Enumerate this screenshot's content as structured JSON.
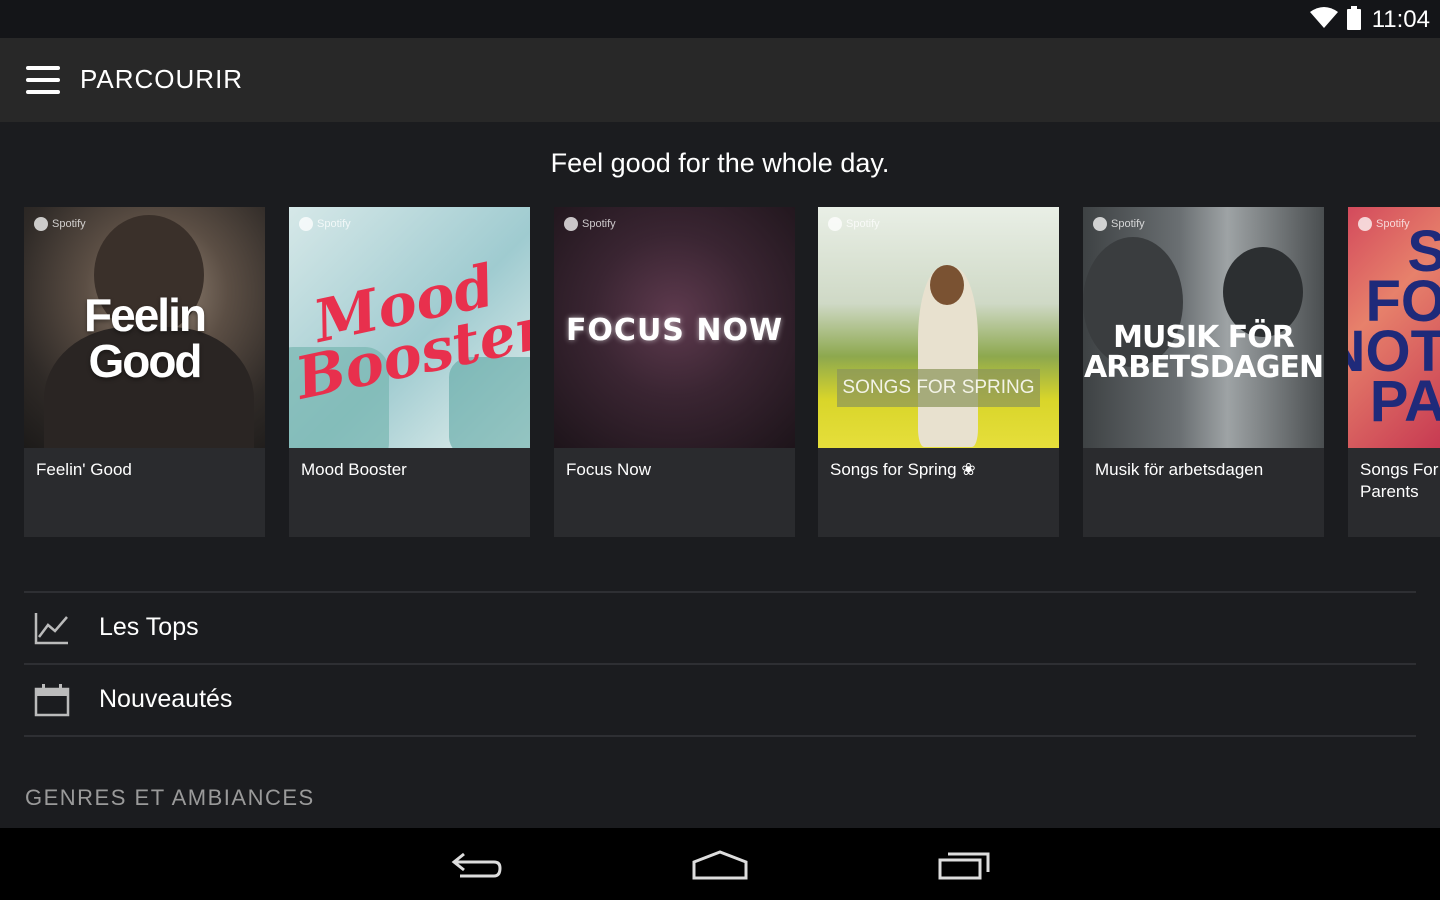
{
  "status_bar": {
    "time": "11:04"
  },
  "app_bar": {
    "title": "PARCOURIR"
  },
  "featured": {
    "tagline": "Feel good for the whole day.",
    "playlists": [
      {
        "label": "Feelin' Good",
        "art_text": "Feelin Good"
      },
      {
        "label": "Mood Booster",
        "art_text": "Mood Booster"
      },
      {
        "label": "Focus Now",
        "art_text": "FOCUS NOW"
      },
      {
        "label": "Songs for Spring ❀",
        "art_text": "SONGS FOR SPRING"
      },
      {
        "label": "Musik för arbetsdagen",
        "art_text": "MUSIK FÖR ARBETSDAGEN"
      },
      {
        "label": "Songs For Parents",
        "art_text": "S FO NOT PA"
      }
    ],
    "brand_mark": "Spotify"
  },
  "menu_rows": [
    {
      "label": "Les Tops",
      "icon": "chart-line-icon"
    },
    {
      "label": "Nouveautés",
      "icon": "calendar-icon"
    }
  ],
  "sections": {
    "genres_heading": "GENRES ET AMBIANCES"
  },
  "colors": {
    "background": "#1b1c1f",
    "app_bar": "#282828",
    "card": "#2a2b2e",
    "accent_red": "#e8304d"
  }
}
